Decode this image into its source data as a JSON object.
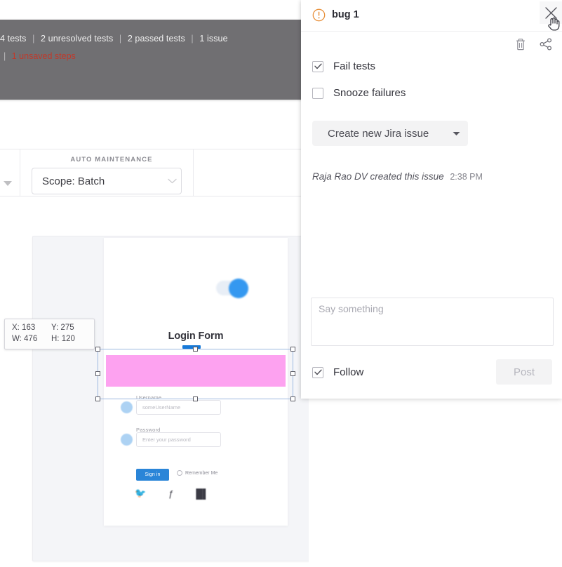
{
  "status_bar": {
    "items": [
      "4 tests",
      "2 unresolved tests",
      "2 passed tests",
      "1 issue"
    ],
    "separator": "|",
    "unsaved": "1 unsaved steps",
    "unsaved_color": "#c0392b"
  },
  "toolbar": {
    "auto_maintenance_label": "AUTO MAINTENANCE",
    "scope_value": "Scope: Batch",
    "caret_icon": "chevron-down-icon",
    "left_caret_icon": "caret-down-icon"
  },
  "coord_tooltip": {
    "x_label": "X: 163",
    "y_label": "Y: 275",
    "w_label": "W: 476",
    "h_label": "H: 120"
  },
  "login_preview": {
    "title": "Login Form",
    "username_label": "Username",
    "username_value": "someUserName",
    "password_label": "Password",
    "password_placeholder": "Enter your password",
    "signin_label": "Sign in",
    "remember_label": "Remember Me",
    "social_icons": [
      "twitter-icon",
      "facebook-icon",
      "linkedin-icon"
    ],
    "selection_color": "#fda2f0"
  },
  "issue_panel": {
    "title": "bug 1",
    "bug_icon": "alert-circle-icon",
    "close_icon": "close-icon",
    "cursor_icon": "pointer-hand-cursor",
    "trash_icon": "trash-icon",
    "share_icon": "share-icon",
    "fail_tests_label": "Fail tests",
    "fail_tests_checked": true,
    "snooze_label": "Snooze failures",
    "snooze_checked": false,
    "jira_label": "Create new Jira issue",
    "jira_caret_icon": "caret-down-icon",
    "activity_author": "Raja Rao DV created this issue",
    "activity_time": "2:38 PM",
    "comment_placeholder": "Say something",
    "follow_label": "Follow",
    "follow_checked": true,
    "post_label": "Post"
  }
}
